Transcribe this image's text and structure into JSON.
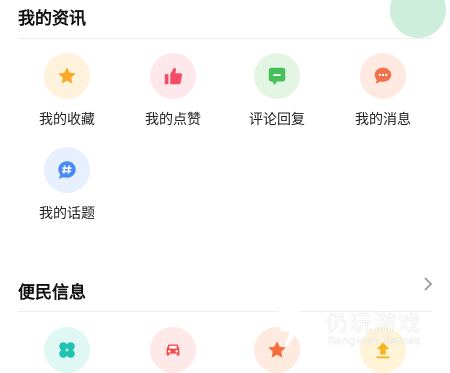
{
  "my_info": {
    "title": "我的资讯",
    "items": [
      {
        "label": "我的收藏",
        "icon": "star-icon",
        "bg": "#fff2dc",
        "color": "#f9a925"
      },
      {
        "label": "我的点赞",
        "icon": "thumbs-up-icon",
        "bg": "#ffe8ec",
        "color": "#f24e67"
      },
      {
        "label": "评论回复",
        "icon": "comment-reply-icon",
        "bg": "#e3f6e3",
        "color": "#46c05b"
      },
      {
        "label": "我的消息",
        "icon": "message-icon",
        "bg": "#ffe9e1",
        "color": "#f2704a"
      },
      {
        "label": "我的话题",
        "icon": "topic-hash-icon",
        "bg": "#e7f0fe",
        "color": "#4a8af5"
      }
    ]
  },
  "convenience": {
    "title": "便民信息",
    "items": [
      {
        "icon": "clover-icon",
        "bg": "#dff8f4",
        "color": "#1fc4b0"
      },
      {
        "icon": "car-icon",
        "bg": "#ffe8e8",
        "color": "#f24d4d"
      },
      {
        "icon": "star-icon",
        "bg": "#ffeadf",
        "color": "#f76c3b"
      },
      {
        "icon": "upload-arrow-icon",
        "bg": "#fff3d8",
        "color": "#f7b31c"
      }
    ]
  },
  "watermark": {
    "title": "仍玩游戏",
    "subtitle": "Rengwan Games"
  }
}
